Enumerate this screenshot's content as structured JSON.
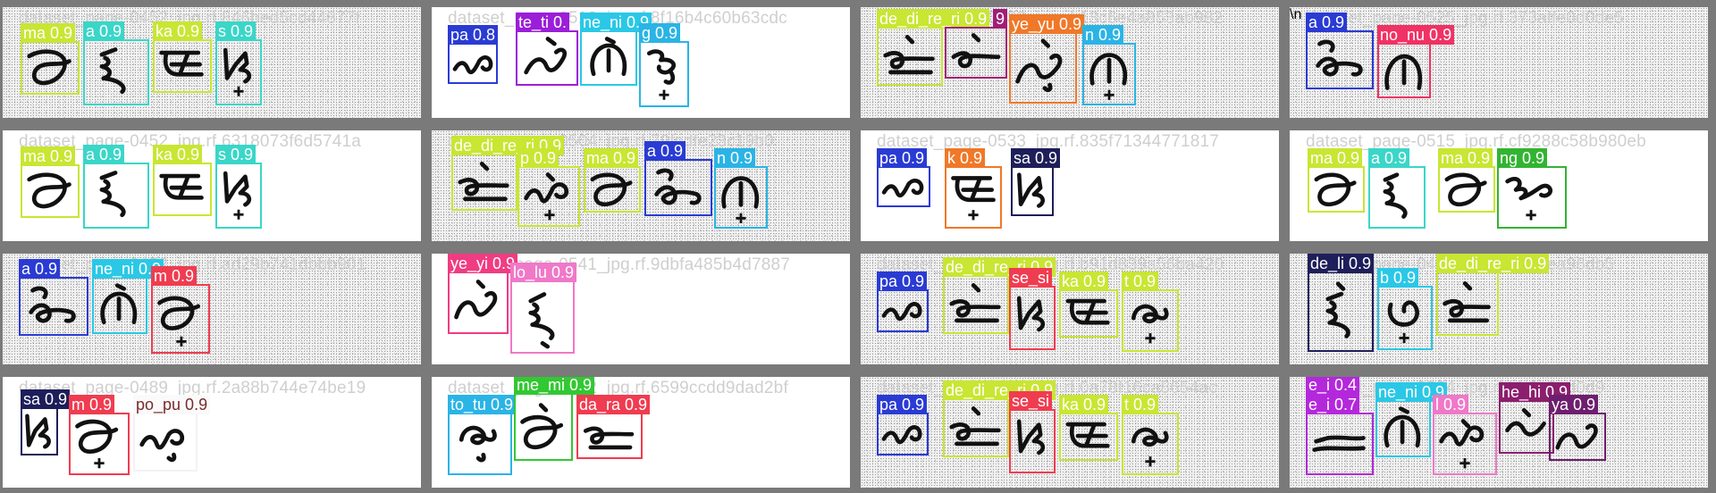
{
  "image_description_free": true,
  "cells": [
    {
      "filename": "dataset_page-0452_jpg.rf.846bed5cd44877f",
      "noisy": true,
      "detections": [
        {
          "label": "ma 0.9",
          "color": "#c8e632",
          "glyph": "ma"
        },
        {
          "label": "a 0.9",
          "color": "#3ad6c8",
          "glyph": "a"
        },
        {
          "label": "ka 0.9",
          "color": "#c8e632",
          "glyph": "ka"
        },
        {
          "label": "s 0.9",
          "color": "#3ad6c8",
          "glyph": "sa",
          "plus": true
        }
      ]
    },
    {
      "filename": "dataset_page-0512_jpg.rf.8f16b4c60b63cdc",
      "noisy": false,
      "detections": [
        {
          "label": "pa 0.8",
          "color": "#2a3bd4",
          "glyph": "pa"
        },
        {
          "label": "te_ti 0.",
          "color": "#9b1ed8",
          "glyph": "ti"
        },
        {
          "label": "ne_ni 0.9",
          "color": "#2ac8e6",
          "glyph": "ni"
        },
        {
          "label": "g 0.9",
          "color": "#2ab4e6",
          "glyph": "ga",
          "plus": true
        }
      ]
    },
    {
      "filename": "dataset_page-0533_jpg.rf.13c6e4a853ab982",
      "noisy": true,
      "detections": [
        {
          "label": "de_di_re_ri 0.9",
          "color": "#c8e632",
          "glyph": "di"
        },
        {
          "label": "9",
          "color": "#a01e78",
          "glyph": "ri"
        },
        {
          "label": "ye_yu 0.9",
          "color": "#f07828",
          "glyph": "yi"
        },
        {
          "label": "n 0.9",
          "color": "#2ab4e6",
          "glyph": "na",
          "plus": true
        }
      ]
    },
    {
      "filename": "dataset_page-0525_jpg.rf.373affe0d0de5",
      "noisy": true,
      "detections": [
        {
          "label": "a 0.9",
          "color": "#2a3bd4",
          "glyph": "a2"
        },
        {
          "label": "no_nu 0.9",
          "color": "#f03264",
          "glyph": "nu"
        }
      ]
    },
    {
      "filename": "dataset_page-0452_jpg.rf.6318073f6d5741a",
      "noisy": false,
      "detections": [
        {
          "label": "ma 0.9",
          "color": "#c8e632",
          "glyph": "ma"
        },
        {
          "label": "a 0.9",
          "color": "#3ad6c8",
          "glyph": "a"
        },
        {
          "label": "ka 0.9",
          "color": "#c8e632",
          "glyph": "ka"
        },
        {
          "label": "s 0.9",
          "color": "#3ad6c8",
          "glyph": "sa",
          "plus": true
        }
      ]
    },
    {
      "filename": "dataset_page-0504_jpg.rf.79fcdfe23c19b0",
      "noisy": true,
      "detections": [
        {
          "label": "de_di_re_ri 0.9",
          "color": "#c8e632",
          "glyph": "di"
        },
        {
          "label": "p 0.9",
          "color": "#c8e632",
          "glyph": "pa",
          "plus": true
        },
        {
          "label": "ma 0.9",
          "color": "#c8e632",
          "glyph": "ma"
        },
        {
          "label": "a 0.9",
          "color": "#2a3bd4",
          "glyph": "a2"
        },
        {
          "label": "n 0.9",
          "color": "#2ab4e6",
          "glyph": "na",
          "plus": true
        }
      ]
    },
    {
      "filename": "dataset_page-0533_jpg.rf.835f71344771817",
      "noisy": false,
      "detections": [
        {
          "label": "pa 0.9",
          "color": "#2a3bd4",
          "glyph": "pa"
        },
        {
          "label": "k 0.9",
          "color": "#f07828",
          "glyph": "ka",
          "plus": true
        },
        {
          "label": "sa 0.9",
          "color": "#1e1e5a",
          "glyph": "sa"
        }
      ]
    },
    {
      "filename": "dataset_page-0515_jpg.rf.cf9288c58b980eb",
      "noisy": false,
      "detections": [
        {
          "label": "ma 0.9",
          "color": "#c8e632",
          "glyph": "ma"
        },
        {
          "label": "a 0.9",
          "color": "#3ad6c8",
          "glyph": "a"
        },
        {
          "label": "ma 0.9",
          "color": "#c8e632",
          "glyph": "ma"
        },
        {
          "label": "ng 0.9",
          "color": "#32b432",
          "glyph": "nga",
          "plus": true
        }
      ]
    },
    {
      "filename": "dataset_page-0452_jpg.rf.ad29b741dbbb901",
      "noisy": true,
      "detections": [
        {
          "label": "a 0.9",
          "color": "#2a3bd4",
          "glyph": "a2"
        },
        {
          "label": "ne_ni 0.9",
          "color": "#2ac8e6",
          "glyph": "ni"
        },
        {
          "label": "m 0.9",
          "color": "#f03c50",
          "glyph": "ma",
          "plus": true
        }
      ]
    },
    {
      "filename": "dataset_page-0541_jpg.rf.9dbfa485b4d7887",
      "noisy": false,
      "detections": [
        {
          "label": "ye_yi 0.9",
          "color": "#f03c82",
          "glyph": "yi"
        },
        {
          "label": "lo_lu 0.9",
          "color": "#f078c8",
          "glyph": "lu"
        }
      ]
    },
    {
      "filename": "dataset_page-0502_jpg.rf.b91d839a56ba420",
      "noisy": true,
      "detections": [
        {
          "label": "pa 0.9",
          "color": "#2a3bd4",
          "glyph": "pa"
        },
        {
          "label": "de_di_re_ri 0.9",
          "color": "#c8e632",
          "glyph": "di"
        },
        {
          "label": "se_si",
          "color": "#f03c50",
          "glyph": "sa"
        },
        {
          "label": "ka 0.9",
          "color": "#c8e632",
          "glyph": "ka"
        },
        {
          "label": "t 0.9",
          "color": "#c8e632",
          "glyph": "ta",
          "plus": true
        }
      ]
    },
    {
      "filename": "dataset_page-0496_jpg.rf.de46ea96db5",
      "noisy": true,
      "detections": [
        {
          "label": "de_li 0.9",
          "color": "#1e1e5a",
          "glyph": "li"
        },
        {
          "label": "b 0.9",
          "color": "#2ac8e6",
          "glyph": "ba",
          "plus": true
        },
        {
          "label": "de_di_re_ri 0.9",
          "color": "#c8e632",
          "glyph": "di"
        }
      ]
    },
    {
      "filename": "dataset_page-0489_jpg.rf.2a88b744e74be19",
      "noisy": false,
      "detections": [
        {
          "label": "sa 0.9",
          "color": "#1e1e5a",
          "glyph": "sa"
        },
        {
          "label": "m 0.9",
          "color": "#f03c50",
          "glyph": "ma",
          "plus": true
        },
        {
          "label": "po_pu 0.9",
          "color": "#fafafa",
          "textcolor": "#7a2a2a",
          "glyph": "pu"
        }
      ]
    },
    {
      "filename": "dataset_page-0512_jpg.rf.6599ccdd9dad2bf",
      "noisy": false,
      "detections": [
        {
          "label": "to_tu 0.9",
          "color": "#2ab4e6",
          "glyph": "tu"
        },
        {
          "label": "me_mi 0.9",
          "color": "#32c832",
          "glyph": "mi"
        },
        {
          "label": "da_ra 0.9",
          "color": "#f03c50",
          "glyph": "da"
        }
      ]
    },
    {
      "filename": "dataset_page-0502_jpg.rf.0a78f16ca8654ac",
      "noisy": true,
      "detections": [
        {
          "label": "pa 0.9",
          "color": "#2a3bd4",
          "glyph": "pa"
        },
        {
          "label": "de_di_re_ri 0.9",
          "color": "#c8e632",
          "glyph": "di"
        },
        {
          "label": "se_si",
          "color": "#f03c50",
          "glyph": "sa"
        },
        {
          "label": "ka 0.9",
          "color": "#c8e632",
          "glyph": "ka"
        },
        {
          "label": "t 0.9",
          "color": "#c8e632",
          "glyph": "ta",
          "plus": true
        }
      ]
    },
    {
      "filename": "dataset_page-0504_jpg.rf.bb6e8ed0d9",
      "noisy": true,
      "detections": [
        {
          "label": "e_i 0.7",
          "color": "#b428dc",
          "glyph": "ei"
        },
        {
          "label": "e_i 0.4",
          "color": "#b428dc",
          "glyph": "none"
        },
        {
          "label": "ne_ni 0.9",
          "color": "#2ac8e6",
          "glyph": "ni"
        },
        {
          "label": "l 0.9",
          "color": "#f078c8",
          "glyph": "la",
          "plus": true
        },
        {
          "label": "he_hi 0.9",
          "color": "#8c1e6e",
          "glyph": "hi"
        },
        {
          "label": "ya 0.9",
          "color": "#6e1e6e",
          "glyph": "ya"
        }
      ]
    }
  ]
}
